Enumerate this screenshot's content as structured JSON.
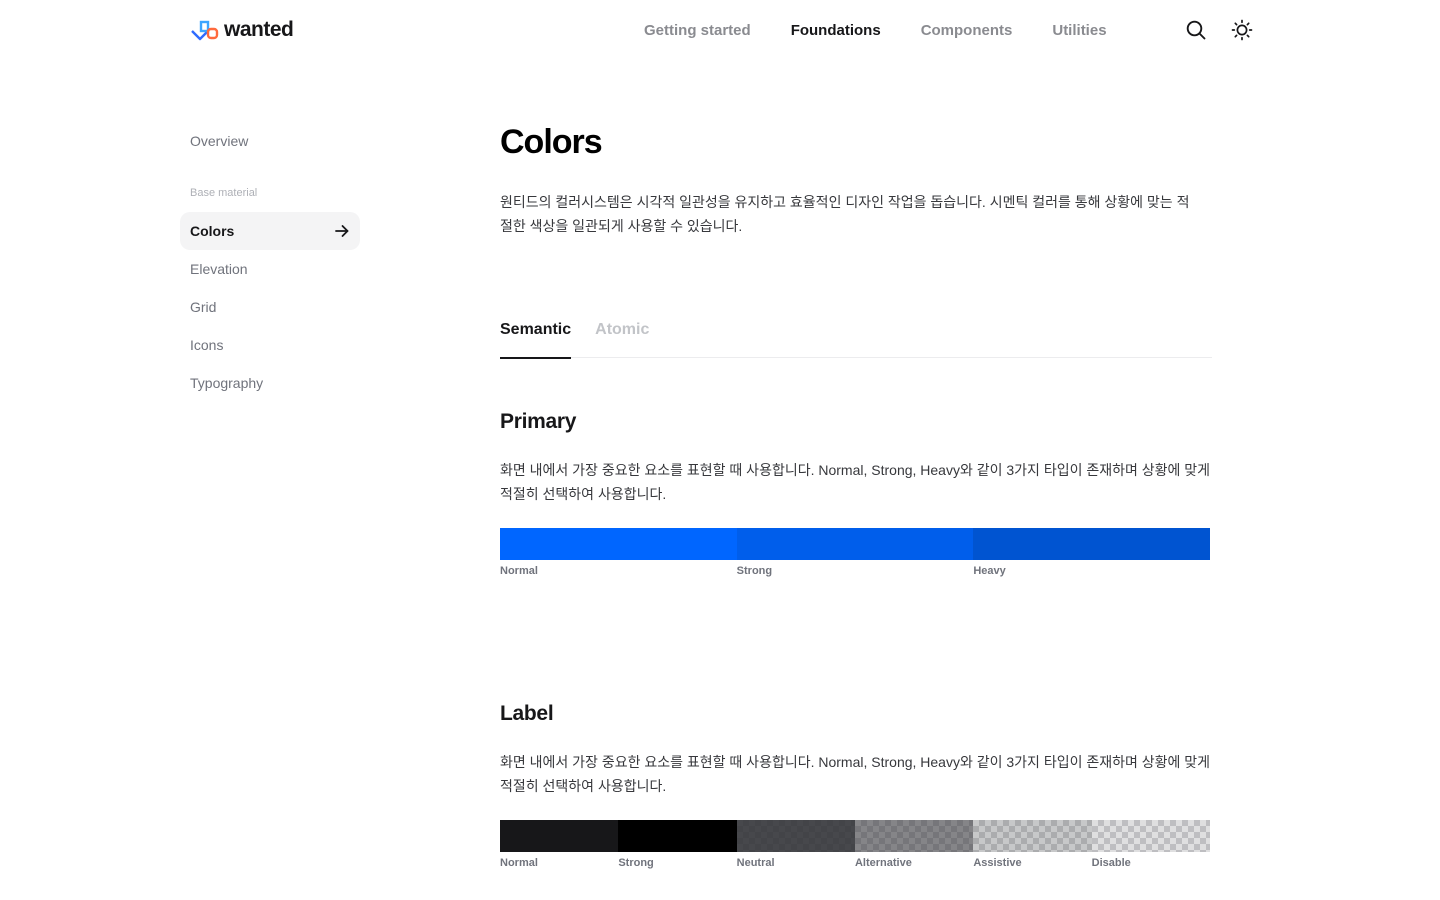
{
  "header": {
    "logo_text": "wanted",
    "nav": [
      {
        "label": "Getting started",
        "active": false
      },
      {
        "label": "Foundations",
        "active": true
      },
      {
        "label": "Components",
        "active": false
      },
      {
        "label": "Utilities",
        "active": false
      }
    ],
    "icons": [
      "search-icon",
      "sun-icon"
    ]
  },
  "sidebar": {
    "overview": "Overview",
    "group_label": "Base material",
    "items": [
      {
        "label": "Colors",
        "active": true
      },
      {
        "label": "Elevation",
        "active": false
      },
      {
        "label": "Grid",
        "active": false
      },
      {
        "label": "Icons",
        "active": false
      },
      {
        "label": "Typography",
        "active": false
      }
    ]
  },
  "main": {
    "title": "Colors",
    "description": "원티드의 컬러시스템은 시각적 일관성을 유지하고 효율적인 디자인 작업을 돕습니다. 시멘틱 컬러를 통해 상황에 맞는 적절한 색상을 일관되게 사용할 수 있습니다.",
    "tabs": [
      {
        "label": "Semantic",
        "active": true
      },
      {
        "label": "Atomic",
        "active": false
      }
    ],
    "sections": [
      {
        "title": "Primary",
        "description": "화면 내에서 가장 중요한 요소를 표현할 때 사용합니다. Normal, Strong, Heavy와 같이 3가지 타입이 존재하며 상황에 맞게 적절히 선택하여 사용합니다.",
        "swatches": [
          {
            "label": "Normal",
            "color": "#0066ff"
          },
          {
            "label": "Strong",
            "color": "#005eeb"
          },
          {
            "label": "Heavy",
            "color": "#0054d1"
          }
        ]
      },
      {
        "title": "Label",
        "description": "화면 내에서 가장 중요한 요소를 표현할 때 사용합니다. Normal, Strong, Heavy와 같이 3가지 타입이 존재하며 상황에 맞게 적절히 선택하여 사용합니다.",
        "swatches": [
          {
            "label": "Normal",
            "color": "#171719",
            "opacity": 1
          },
          {
            "label": "Strong",
            "color": "#000000",
            "opacity": 1
          },
          {
            "label": "Neutral",
            "color": "#2e2f33",
            "opacity": 0.88
          },
          {
            "label": "Alternative",
            "color": "#37383c",
            "opacity": 0.61
          },
          {
            "label": "Assistive",
            "color": "#37383c",
            "opacity": 0.28
          },
          {
            "label": "Disable",
            "color": "#37383c",
            "opacity": 0.16
          }
        ]
      }
    ]
  }
}
